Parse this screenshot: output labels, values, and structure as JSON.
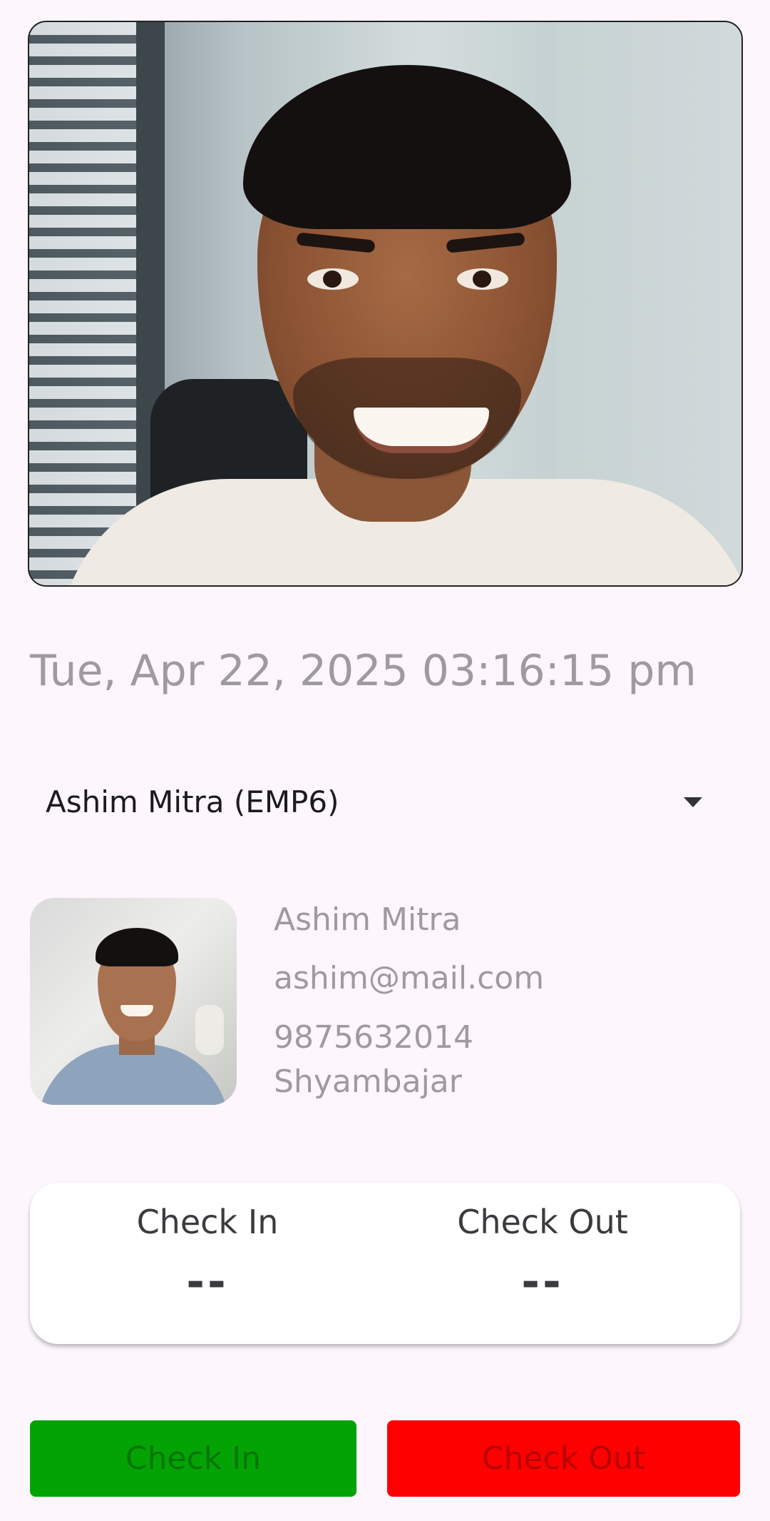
{
  "datetime": "Tue, Apr 22, 2025 03:16:15 pm",
  "employee_select": {
    "selected": "Ashim Mitra (EMP6)",
    "icon": "dropdown-caret-icon"
  },
  "employee": {
    "name": "Ashim Mitra",
    "email": "ashim@mail.com",
    "phone": "9875632014",
    "location": "Shyambajar"
  },
  "status": {
    "check_in_label": "Check In",
    "check_in_value": "--",
    "check_out_label": "Check Out",
    "check_out_value": "--"
  },
  "actions": {
    "check_in": "Check In",
    "check_out": "Check Out"
  },
  "colors": {
    "background": "#fdf6fd",
    "check_in_button": "#03a303",
    "check_out_button": "#ff0000"
  }
}
